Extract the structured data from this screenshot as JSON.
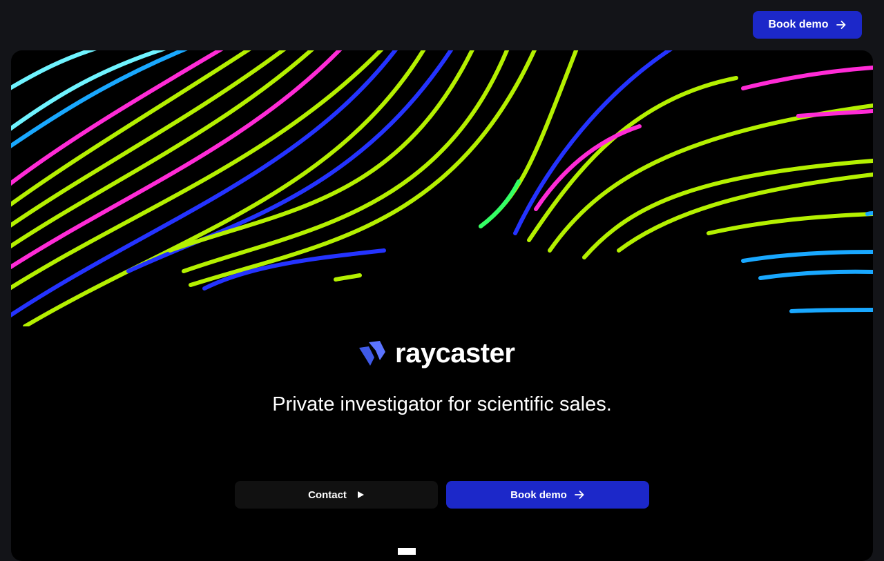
{
  "header": {
    "book_demo_label": "Book demo"
  },
  "hero": {
    "logo_text": "raycaster",
    "tagline": "Private investigator for scientific sales.",
    "contact_label": "Contact",
    "book_demo_label": "Book demo"
  },
  "colors": {
    "page_background": "#131418",
    "hero_background": "#000000",
    "accent_blue": "#1c28c9",
    "wave_lime": "#b4f000",
    "wave_magenta": "#ff2bd6",
    "wave_blue": "#2433ff",
    "wave_cyan": "#19a8ff"
  },
  "icons": {
    "header_button_icon": "arrow-right-icon",
    "contact_icon": "play-icon",
    "demo_button_icon": "arrow-right-icon",
    "logo_mark": "raycaster-logo-icon"
  }
}
